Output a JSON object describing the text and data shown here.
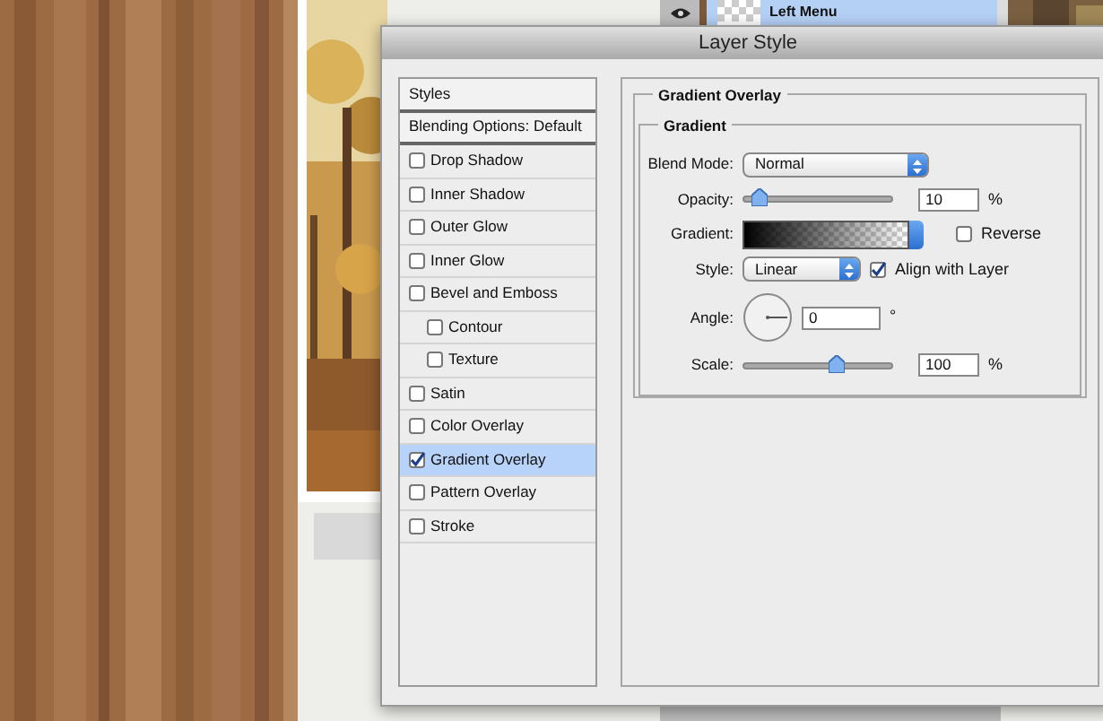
{
  "layers_panel": {
    "layer_name": "Left Menu",
    "selected": true
  },
  "dialog": {
    "title": "Layer Style"
  },
  "styles_list": [
    {
      "label": "Styles",
      "kind": "header"
    },
    {
      "label": "Blending Options: Default",
      "kind": "header"
    },
    {
      "label": "Drop Shadow",
      "kind": "checkbox",
      "checked": false,
      "selected": false
    },
    {
      "label": "Inner Shadow",
      "kind": "checkbox",
      "checked": false,
      "selected": false
    },
    {
      "label": "Outer Glow",
      "kind": "checkbox",
      "checked": false,
      "selected": false
    },
    {
      "label": "Inner Glow",
      "kind": "checkbox",
      "checked": false,
      "selected": false
    },
    {
      "label": "Bevel and Emboss",
      "kind": "checkbox",
      "checked": false,
      "selected": false,
      "children": [
        {
          "label": "Contour",
          "kind": "checkbox",
          "checked": false,
          "selected": false
        },
        {
          "label": "Texture",
          "kind": "checkbox",
          "checked": false,
          "selected": false
        }
      ]
    },
    {
      "label": "Satin",
      "kind": "checkbox",
      "checked": false,
      "selected": false
    },
    {
      "label": "Color Overlay",
      "kind": "checkbox",
      "checked": false,
      "selected": false
    },
    {
      "label": "Gradient Overlay",
      "kind": "checkbox",
      "checked": true,
      "selected": true
    },
    {
      "label": "Pattern Overlay",
      "kind": "checkbox",
      "checked": false,
      "selected": false
    },
    {
      "label": "Stroke",
      "kind": "checkbox",
      "checked": false,
      "selected": false
    }
  ],
  "panel": {
    "title": "Gradient Overlay",
    "group_title": "Gradient",
    "blend_mode": {
      "label": "Blend Mode:",
      "value": "Normal"
    },
    "opacity": {
      "label": "Opacity:",
      "level": 0.1,
      "value": "10",
      "unit": "%"
    },
    "gradient": {
      "label": "Gradient:"
    },
    "reverse": {
      "label": "Reverse",
      "checked": false
    },
    "style": {
      "label": "Style:",
      "value": "Linear"
    },
    "align_with_layer": {
      "label": "Align with Layer",
      "checked": true
    },
    "angle": {
      "label": "Angle:",
      "value": "0",
      "unit": "°"
    },
    "scale": {
      "label": "Scale:",
      "level": 0.62,
      "value": "100",
      "unit": "%"
    }
  }
}
